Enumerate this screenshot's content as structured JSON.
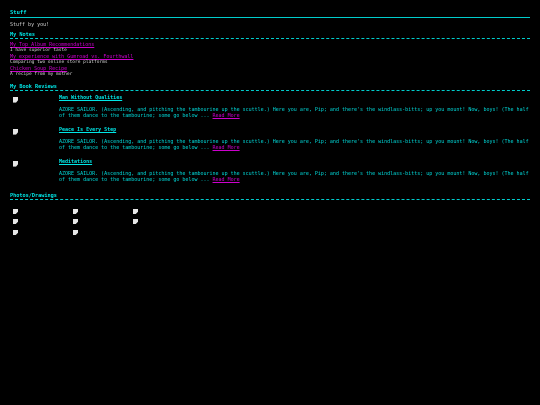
{
  "page": {
    "title": "Stuff",
    "intro": "Stuff by you!"
  },
  "notes": {
    "heading": "My Notes",
    "items": [
      {
        "title": "My Top Album Recommendations",
        "description": "I have superior taste"
      },
      {
        "title": "My experience with Gumroad vs. Fourthwall",
        "description": "Comparing two online store platforms"
      },
      {
        "title": "Chicken Soup Recipe",
        "description": "A recipe from my mother"
      }
    ]
  },
  "reviews": {
    "heading": "My Book Reviews",
    "read_more_label": "Read More",
    "items": [
      {
        "title": "Man Without Qualities",
        "excerpt": "AZORE SAILOR. (Ascending, and pitching the tambourine up the scuttle.) Here you are, Pip; and there's the windlass-bitts; up you mount! Now, boys! (The half of them dance to the tambourine; some go below ..."
      },
      {
        "title": "Peace Is Every Step",
        "excerpt": "AZORE SAILOR. (Ascending, and pitching the tambourine up the scuttle.) Here you are, Pip; and there's the windlass-bitts; up you mount! Now, boys! (The half of them dance to the tambourine; some go below ..."
      },
      {
        "title": "Meditations",
        "excerpt": "AZORE SAILOR. (Ascending, and pitching the tambourine up the scuttle.) Here you are, Pip; and there's the windlass-bitts; up you mount! Now, boys! (The half of them dance to the tambourine; some go below ..."
      }
    ]
  },
  "photos": {
    "heading": "Photos/Drawings"
  },
  "colors": {
    "background": "#000000",
    "accent": "#00e6e6",
    "link": "#cc00cc",
    "muted_text": "#d8d8d8"
  }
}
